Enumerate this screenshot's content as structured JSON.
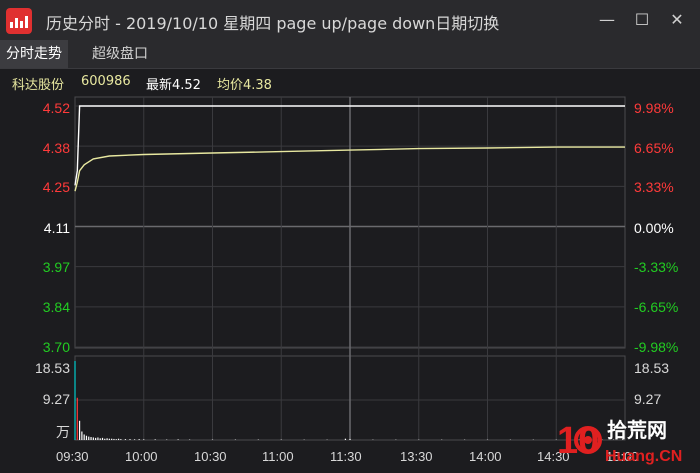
{
  "window": {
    "title": "历史分时 - 2019/10/10 星期四 page up/page down日期切换",
    "minimize": "—",
    "maximize": "☐",
    "close": "✕"
  },
  "tabs": [
    {
      "label": "分时走势",
      "active": true
    },
    {
      "label": "超级盘口",
      "active": false
    }
  ],
  "stock": {
    "name": "科达股份",
    "code": "600986",
    "latest": "最新4.52",
    "avg": "均价4.38"
  },
  "colors": {
    "up": "#ff3a3a",
    "down": "#22cc22",
    "flat": "#ffffff",
    "avg_line": "#e8e8a0",
    "price_line": "#ffffff",
    "volume_bar": "#ffffff",
    "volume_first": "#00cccc"
  },
  "units": {
    "volume": "万"
  },
  "watermark": {
    "text": "10 拾荒网",
    "sub": "Huang.CN",
    "digits": "10",
    "name": "拾荒网"
  },
  "chart_data": {
    "type": "line",
    "prev_close": 4.11,
    "price_axis": {
      "labels": [
        "4.52",
        "4.38",
        "4.25",
        "4.11",
        "3.97",
        "3.84",
        "3.70"
      ],
      "range": [
        3.7,
        4.52
      ]
    },
    "pct_axis": {
      "labels": [
        "9.98%",
        "6.65%",
        "3.33%",
        "0.00%",
        "-3.33%",
        "-6.65%",
        "-9.98%"
      ]
    },
    "volume_axis": {
      "labels": [
        "18.53",
        "9.27",
        "万"
      ],
      "max": 18.53
    },
    "x_ticks": [
      "09:30",
      "10:00",
      "10:30",
      "11:00",
      "11:30",
      "13:30",
      "14:00",
      "14:30",
      "15:00"
    ],
    "series": [
      {
        "name": "最新",
        "points": [
          [
            0,
            4.25
          ],
          [
            1,
            4.3
          ],
          [
            2,
            4.52
          ],
          [
            240,
            4.52
          ]
        ]
      },
      {
        "name": "均价",
        "points": [
          [
            0,
            4.23
          ],
          [
            1,
            4.26
          ],
          [
            2,
            4.3
          ],
          [
            4,
            4.32
          ],
          [
            8,
            4.34
          ],
          [
            15,
            4.35
          ],
          [
            30,
            4.355
          ],
          [
            60,
            4.36
          ],
          [
            90,
            4.365
          ],
          [
            120,
            4.37
          ],
          [
            150,
            4.375
          ],
          [
            180,
            4.377
          ],
          [
            210,
            4.38
          ],
          [
            240,
            4.38
          ]
        ]
      }
    ],
    "volume": [
      [
        0,
        18.53
      ],
      [
        1,
        9.9
      ],
      [
        2,
        4.5
      ],
      [
        3,
        2.0
      ],
      [
        4,
        1.3
      ],
      [
        5,
        1.0
      ],
      [
        6,
        0.8
      ],
      [
        7,
        0.7
      ],
      [
        8,
        0.6
      ],
      [
        9,
        0.5
      ],
      [
        10,
        0.6
      ],
      [
        11,
        0.4
      ],
      [
        12,
        0.5
      ],
      [
        13,
        0.3
      ],
      [
        14,
        0.4
      ],
      [
        15,
        0.3
      ],
      [
        16,
        0.3
      ],
      [
        17,
        0.25
      ],
      [
        18,
        0.2
      ],
      [
        19,
        0.3
      ],
      [
        20,
        0.2
      ],
      [
        22,
        0.2
      ],
      [
        24,
        0.2
      ],
      [
        26,
        0.15
      ],
      [
        28,
        0.2
      ],
      [
        30,
        0.15
      ],
      [
        35,
        0.15
      ],
      [
        40,
        0.1
      ],
      [
        45,
        0.15
      ],
      [
        50,
        0.1
      ],
      [
        60,
        0.1
      ],
      [
        70,
        0.1
      ],
      [
        80,
        0.1
      ],
      [
        90,
        0.1
      ],
      [
        100,
        0.08
      ],
      [
        110,
        0.08
      ],
      [
        118,
        0.3
      ],
      [
        120,
        0.25
      ],
      [
        130,
        0.08
      ],
      [
        140,
        0.08
      ],
      [
        150,
        0.08
      ],
      [
        160,
        0.08
      ],
      [
        170,
        0.08
      ],
      [
        180,
        0.08
      ],
      [
        190,
        0.08
      ],
      [
        200,
        0.08
      ],
      [
        210,
        0.08
      ],
      [
        220,
        0.08
      ],
      [
        230,
        0.08
      ],
      [
        235,
        0.1
      ],
      [
        239,
        0.15
      ]
    ]
  }
}
